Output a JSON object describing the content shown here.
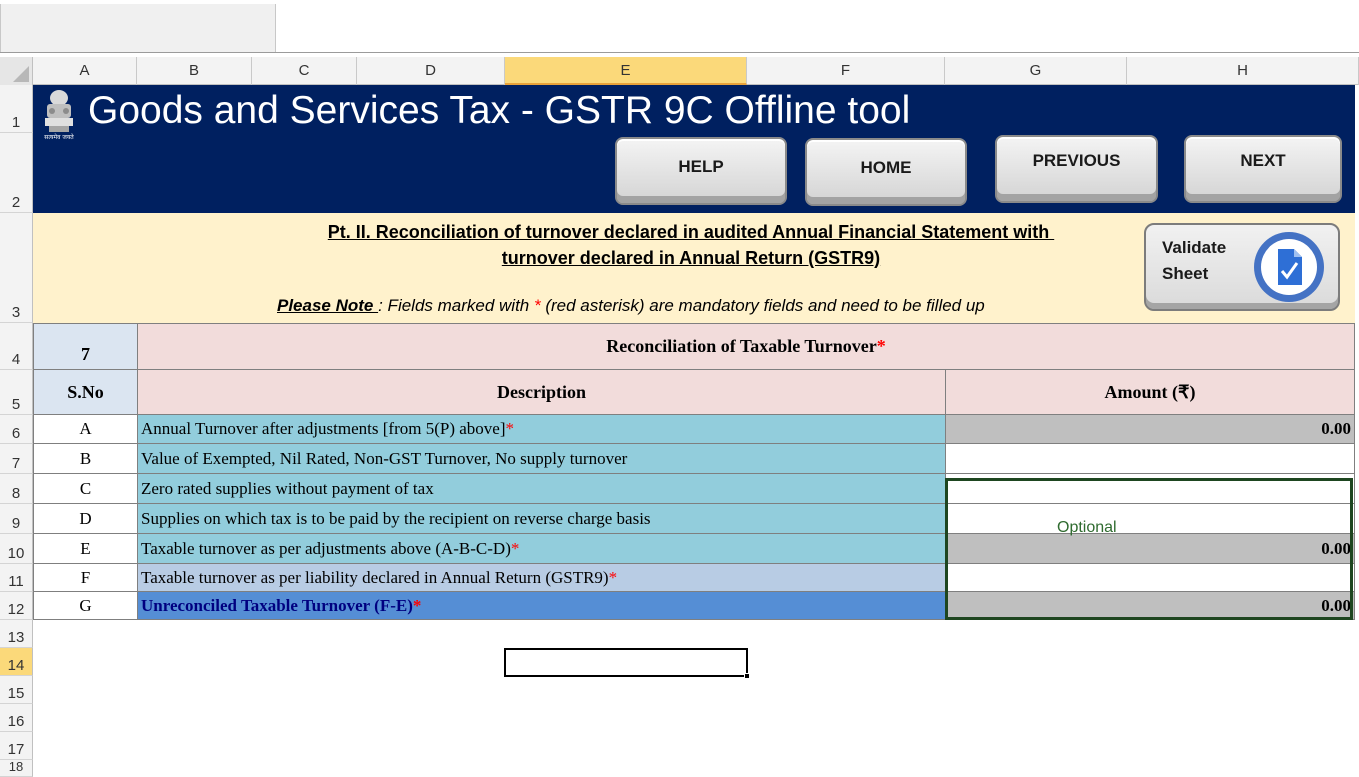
{
  "app": {
    "title": "Goods and Services Tax - GSTR 9C Offline tool",
    "emblem_caption": "सत्यमेव जयते"
  },
  "columns": [
    "A",
    "B",
    "C",
    "D",
    "E",
    "F",
    "G",
    "H"
  ],
  "selected_column": "E",
  "rows": [
    "1",
    "2",
    "3",
    "4",
    "5",
    "6",
    "7",
    "8",
    "9",
    "10",
    "11",
    "12",
    "13",
    "14",
    "15",
    "16",
    "17",
    "18"
  ],
  "selected_row": "14",
  "nav": {
    "help": "HELP",
    "home": "HOME",
    "previous": "PREVIOUS",
    "next": "NEXT"
  },
  "part": {
    "title_line1": "Pt. II. Reconciliation of turnover declared in audited Annual Financial Statement with ",
    "title_line2": "turnover declared in Annual Return (GSTR9)"
  },
  "note": {
    "label": "Please Note ",
    "text_before": ": Fields marked with ",
    "asterisk": "*",
    "text_after": " (red asterisk) are mandatory fields and need to be filled up"
  },
  "validate": {
    "label": "Validate Sheet"
  },
  "table": {
    "section_no": "7",
    "section_title": "Reconciliation of Taxable Turnover",
    "sno_header": "S.No",
    "desc_header": "Description",
    "amount_header": "Amount (₹)",
    "optional_text": "Optional",
    "rows": [
      {
        "label": "A",
        "desc": "Annual Turnover after adjustments [from 5(P) above]",
        "mandatory": "*",
        "amount": "0.00"
      },
      {
        "label": "B",
        "desc": "Value of Exempted, Nil Rated, Non-GST Turnover, No supply turnover",
        "mandatory": "",
        "amount": ""
      },
      {
        "label": "C",
        "desc": "Zero rated supplies without payment of tax",
        "mandatory": "",
        "amount": ""
      },
      {
        "label": "D",
        "desc": "Supplies on which tax is to be paid by the recipient on reverse charge basis",
        "mandatory": "",
        "amount": ""
      },
      {
        "label": "E",
        "desc": "Taxable turnover as per adjustments above (A-B-C-D)",
        "mandatory": "*",
        "amount": "0.00"
      },
      {
        "label": "F",
        "desc": "Taxable turnover as per liability declared in Annual Return (GSTR9)",
        "mandatory": "*",
        "amount": ""
      },
      {
        "label": "G",
        "desc": "Unreconciled Taxable Turnover (F-E)",
        "mandatory": "*",
        "amount": "0.00"
      }
    ]
  },
  "colors": {
    "banner": "#002060",
    "note_band": "#fff2cc",
    "header_pink": "#f2dcdb",
    "desc_teal": "#92cddc",
    "desc_total": "#558ed5",
    "readonly_grey": "#bfbfbf",
    "selection_yellow": "#fbd97a"
  }
}
